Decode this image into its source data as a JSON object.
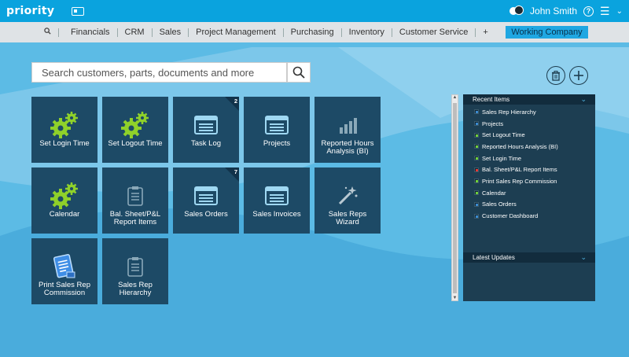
{
  "topbar": {
    "logo": "priority",
    "user_name": "John Smith",
    "help_label": "?"
  },
  "navbar": {
    "items": [
      "Financials",
      "CRM",
      "Sales",
      "Project Management",
      "Purchasing",
      "Inventory",
      "Customer Service",
      "+"
    ],
    "working_company": "Working Company"
  },
  "search": {
    "placeholder": "Search customers, parts, documents and more"
  },
  "tiles": [
    {
      "label": "Set Login Time",
      "icon": "gears-icon",
      "badge": ""
    },
    {
      "label": "Set Logout Time",
      "icon": "gears-icon",
      "badge": ""
    },
    {
      "label": "Task Log",
      "icon": "form-icon",
      "badge": "2"
    },
    {
      "label": "Projects",
      "icon": "form-icon",
      "badge": ""
    },
    {
      "label": "Reported Hours Analysis (BI)",
      "icon": "bar-chart-icon",
      "badge": ""
    },
    {
      "label": "Calendar",
      "icon": "gears-icon",
      "badge": ""
    },
    {
      "label": "Bal. Sheet/P&L Report Items",
      "icon": "clipboard-icon",
      "badge": ""
    },
    {
      "label": "Sales Orders",
      "icon": "form-icon",
      "badge": "7"
    },
    {
      "label": "Sales Invoices",
      "icon": "form-icon",
      "badge": ""
    },
    {
      "label": "Sales Reps Wizard",
      "icon": "wand-icon",
      "badge": ""
    },
    {
      "label": "Print Sales Rep Commission",
      "icon": "document-icon",
      "badge": ""
    },
    {
      "label": "Sales Rep Hierarchy",
      "icon": "clipboard-icon",
      "badge": ""
    }
  ],
  "recent": {
    "title": "Recent Items",
    "items": [
      {
        "label": "Sales Rep Hierarchy",
        "status": "blue"
      },
      {
        "label": "Projects",
        "status": "blue"
      },
      {
        "label": "Set Logout Time",
        "status": "green"
      },
      {
        "label": "Reported Hours Analysis (BI)",
        "status": "green"
      },
      {
        "label": "Set Login Time",
        "status": "green"
      },
      {
        "label": "Bal. Sheet/P&L Report Items",
        "status": "red"
      },
      {
        "label": "Print Sales Rep Commission",
        "status": "green"
      },
      {
        "label": "Calendar",
        "status": "green"
      },
      {
        "label": "Sales Orders",
        "status": "blue"
      },
      {
        "label": "Customer Dashboard",
        "status": "blue"
      }
    ]
  },
  "latest": {
    "title": "Latest Updates"
  },
  "colors": {
    "background": "#4fb3e0",
    "topbar": "#0aa3de",
    "tile": "#1d4a66",
    "accent_green": "#8fd12a"
  }
}
